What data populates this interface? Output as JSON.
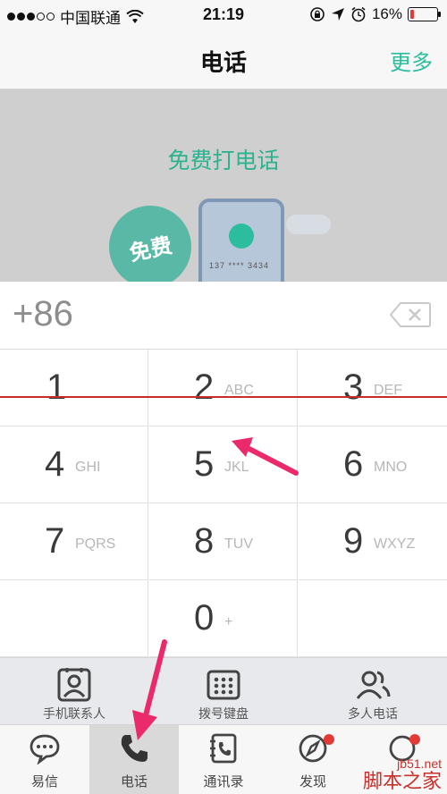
{
  "status_bar": {
    "carrier": "中国联通",
    "time": "21:19",
    "battery": "16%",
    "battery_level": 0.16
  },
  "nav": {
    "title": "电话",
    "more": "更多"
  },
  "banner": {
    "title": "免费打电话",
    "bubble_text": "免费",
    "phone_digits": "137 **** 3434"
  },
  "display": {
    "number": "+86"
  },
  "keypad": {
    "keys": [
      {
        "digit": "1",
        "letters": ""
      },
      {
        "digit": "2",
        "letters": "ABC"
      },
      {
        "digit": "3",
        "letters": "DEF"
      },
      {
        "digit": "4",
        "letters": "GHI"
      },
      {
        "digit": "5",
        "letters": "JKL"
      },
      {
        "digit": "6",
        "letters": "MNO"
      },
      {
        "digit": "7",
        "letters": "PQRS"
      },
      {
        "digit": "8",
        "letters": "TUV"
      },
      {
        "digit": "9",
        "letters": "WXYZ"
      },
      {
        "digit": "",
        "letters": ""
      },
      {
        "digit": "0",
        "letters": "+"
      },
      {
        "digit": "",
        "letters": ""
      }
    ]
  },
  "actions": [
    {
      "label": "手机联系人",
      "icon": "contact-card-icon"
    },
    {
      "label": "拨号键盘",
      "icon": "keypad-icon"
    },
    {
      "label": "多人电话",
      "icon": "group-icon"
    }
  ],
  "tabs": [
    {
      "label": "易信",
      "icon": "chat-bubble-icon",
      "active": false
    },
    {
      "label": "电话",
      "icon": "phone-icon",
      "active": true
    },
    {
      "label": "通讯录",
      "icon": "address-book-icon",
      "active": false
    },
    {
      "label": "发现",
      "icon": "compass-icon",
      "active": false,
      "badge": true
    },
    {
      "label": "",
      "icon": "more-icon",
      "active": false,
      "badge": true
    }
  ],
  "watermark": {
    "site": "jb51.net",
    "name": "脚本之家"
  },
  "colors": {
    "accent": "#2bbd9e",
    "banner_bg": "#cfcfcf",
    "badge": "#e53935"
  }
}
